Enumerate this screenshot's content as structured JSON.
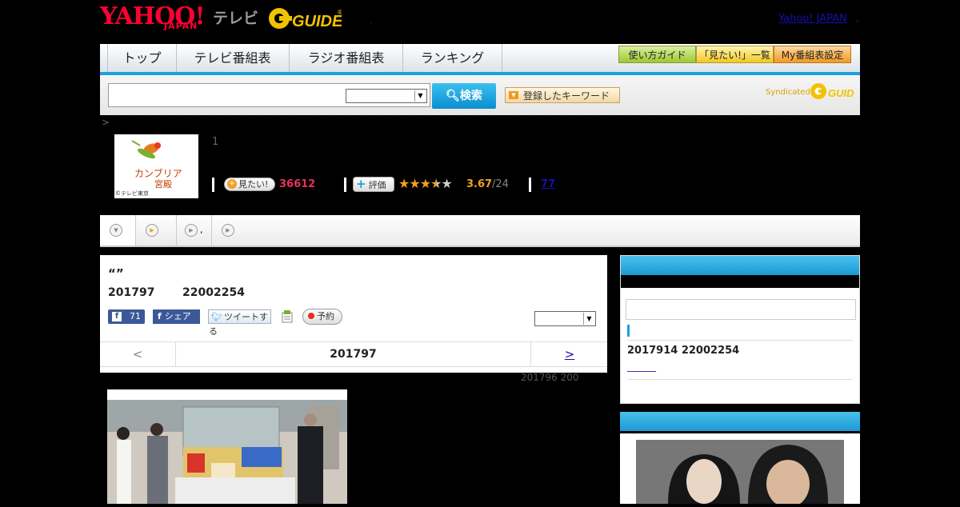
{
  "header": {
    "logo_yahoo": "YAHOO!",
    "logo_japan": "JAPAN",
    "logo_tv": "テレビ",
    "logo_gguide": "G-GUIDE",
    "dot": ",",
    "yahoo_japan_link": "Yahoo! JAPAN",
    "yahoo_japan_sep": ","
  },
  "nav": {
    "items": [
      {
        "label": "トップ"
      },
      {
        "label": "テレビ番組表"
      },
      {
        "label": "ラジオ番組表"
      },
      {
        "label": "ランキング"
      }
    ],
    "guide_buttons": [
      {
        "label": "使い方ガイド"
      },
      {
        "label": "「見たい!」一覧"
      },
      {
        "label": "My番組表設定"
      }
    ]
  },
  "search": {
    "button_label": "検索",
    "keyword_button_label": "登録したキーワード",
    "syndicated": "Syndicated"
  },
  "breadcrumb": ">",
  "program": {
    "rank": "1",
    "thumb_title_line1": "カンブリア",
    "thumb_title_line2": "宮殿",
    "thumb_credit": "©テレビ東京",
    "mitai_label": "見たい!",
    "mitai_count": "36612",
    "hyoka_label": "評価",
    "rating": 3.67,
    "rating_text": "3.67",
    "rating_count": "/24",
    "review_link": "77"
  },
  "tabs": [
    {
      "label": ""
    },
    {
      "label": ","
    },
    {
      "label": ""
    },
    {
      "label": ""
    }
  ],
  "main": {
    "title": "“”",
    "date": "201797",
    "time": "22002254",
    "social": {
      "like_count": "71",
      "share_label": "シェア",
      "tweet_label": "ツイートする",
      "reserve_label": "予約"
    },
    "pager": {
      "prev": "<",
      "current": "201797",
      "next": ">"
    },
    "prev_broadcast": "201796  200"
  },
  "sidebar": {
    "next_broadcast": "2017914  22002254",
    "link_text": "______"
  }
}
